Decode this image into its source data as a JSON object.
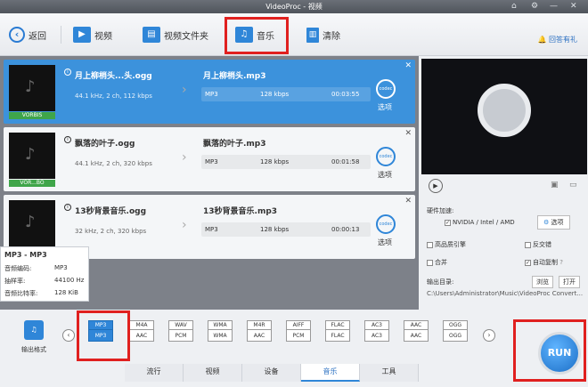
{
  "window": {
    "title": "VideoProc - 视频",
    "controls": [
      "⌂",
      "⚙",
      "—",
      "✕"
    ]
  },
  "toolbar": {
    "back": "返回",
    "video": "视频",
    "video_folder": "视频文件夹",
    "music": "音乐",
    "clear": "清除",
    "help": "回答有礼"
  },
  "files": [
    {
      "name": "月上柳梢头...头.ogg",
      "info": "44.1 kHz, 2 ch, 112 kbps",
      "badge": "VORBIS",
      "out_name": "月上柳梢头.mp3",
      "format": "MP3",
      "bitrate": "128 kbps",
      "duration": "00:03:55",
      "option": "选项",
      "selected": true
    },
    {
      "name": "飘落的叶子.ogg",
      "info": "44.1 kHz, 2 ch, 320 kbps",
      "badge": "VOR...BO",
      "out_name": "飘落的叶子.mp3",
      "format": "MP3",
      "bitrate": "128 kbps",
      "duration": "00:01:58",
      "option": "选项",
      "selected": false
    },
    {
      "name": "13秒背景音乐.ogg",
      "info": "32 kHz, 2 ch, 320 kbps",
      "badge": "",
      "out_name": "13秒背景音乐.mp3",
      "format": "MP3",
      "bitrate": "128 kbps",
      "duration": "00:00:13",
      "option": "选项",
      "selected": false
    }
  ],
  "popup": {
    "title": "MP3 - MP3",
    "rows": [
      {
        "label": "音频编码:",
        "value": "MP3"
      },
      {
        "label": "抽样率:",
        "value": "44100 Hz"
      },
      {
        "label": "音频比特率:",
        "value": "128 KiB"
      }
    ]
  },
  "settings": {
    "hw_label": "硬件加速:",
    "hw_value": "NVIDIA / Intel / AMD",
    "options_btn": "选项",
    "high_quality": "高品质引擎",
    "deinterlace": "反交错",
    "merge": "合并",
    "auto_copy": "自动复制",
    "output_label": "输出目录:",
    "browse": "浏览",
    "open": "打开",
    "output_path": "C:\\Users\\Administrator\\Music\\VideoProc Convert..."
  },
  "formats": {
    "out_format": "输出格式",
    "items": [
      {
        "top": "MP3",
        "bot": "MP3",
        "selected": true
      },
      {
        "top": "M4A",
        "bot": "AAC"
      },
      {
        "top": "WAV",
        "bot": "PCM"
      },
      {
        "top": "WMA",
        "bot": "WMA"
      },
      {
        "top": "M4R",
        "bot": "AAC"
      },
      {
        "top": "AIFF",
        "bot": "PCM"
      },
      {
        "top": "FLAC",
        "bot": "FLAC"
      },
      {
        "top": "AC3",
        "bot": "AC3"
      },
      {
        "top": "AAC",
        "bot": "AAC"
      },
      {
        "top": "OGG",
        "bot": "OGG"
      }
    ]
  },
  "tabs": [
    "流行",
    "视频",
    "设备",
    "音乐",
    "工具"
  ],
  "active_tab": "音乐",
  "run_label": "RUN",
  "colors": {
    "accent": "#2f86d8",
    "highlight": "#e0201f"
  }
}
